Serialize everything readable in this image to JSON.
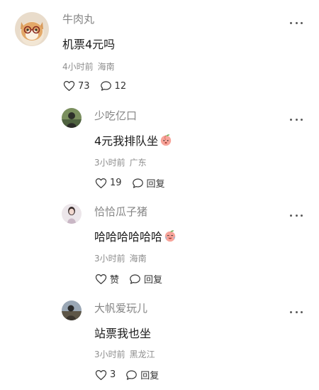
{
  "comments": [
    {
      "username": "牛肉丸",
      "content": "机票4元吗",
      "emoji": "",
      "time": "4小时前",
      "location": "海南",
      "likes": "73",
      "replies": "12"
    },
    {
      "username": "少吃亿口",
      "content": "4元我排队坐",
      "emoji": "peach-face-emoji",
      "time": "3小时前",
      "location": "广东",
      "likes": "19",
      "replies": "回复"
    },
    {
      "username": "恰恰瓜子猪",
      "content": "哈哈哈哈哈哈",
      "emoji": "laughing-cry-emoji",
      "time": "3小时前",
      "location": "海南",
      "likes": "赞",
      "replies": "回复"
    },
    {
      "username": "大帆爱玩儿",
      "content": "站票我也坐",
      "emoji": "",
      "time": "3小时前",
      "location": "黑龙江",
      "likes": "3",
      "replies": "回复"
    }
  ],
  "icons": {
    "like": "heart-outline-icon",
    "reply": "speech-bubble-icon",
    "more": "more-dots-icon"
  }
}
